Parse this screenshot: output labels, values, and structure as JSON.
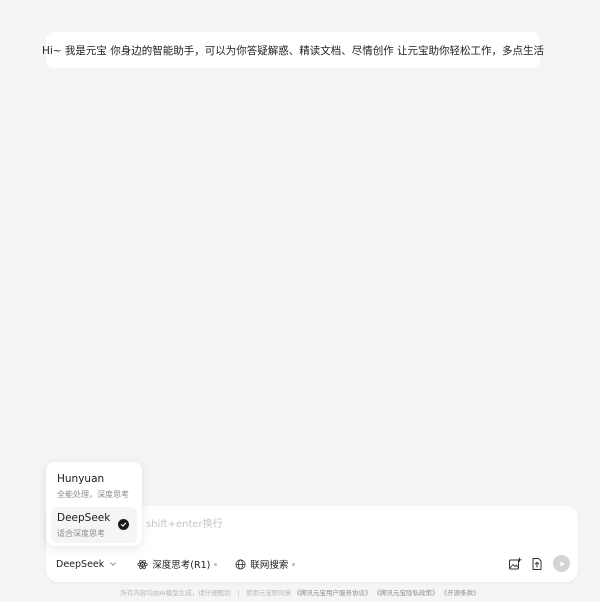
{
  "greeting": {
    "text": "Hi~ 我是元宝 你身边的智能助手，可以为你答疑解惑、精读文档、尽情创作 让元宝助你轻松工作，多点生活"
  },
  "model_menu": {
    "items": [
      {
        "name": "Hunyuan",
        "desc": "全能处理，深度思考"
      },
      {
        "name": "DeepSeek",
        "desc": "适合深度思考"
      }
    ],
    "selected": "DeepSeek"
  },
  "input": {
    "value": "",
    "placeholder": "shift+enter换行"
  },
  "toolbar": {
    "model_label": "DeepSeek",
    "deep_think_label": "深度思考(R1)",
    "web_search_label": "联网搜索"
  },
  "footer": {
    "disclaimer": "所有内容均由AI模型生成，请仔细甄别",
    "agreement_prefix": "使用元宝即同意",
    "link_user_agreement": "《腾讯元宝用户服务协议》",
    "link_privacy": "《腾讯元宝隐私政策》",
    "link_open_source": "《开源条款》"
  },
  "colors": {
    "background": "#f5f5f5",
    "surface": "#ffffff",
    "text": "#1a1a1a",
    "muted": "#8a8a8a",
    "placeholder": "#c4c4c4",
    "send_disabled": "#d4d4d4"
  },
  "icons": {
    "menu_check": "check-circle-icon",
    "model_chevron": "chevron-down-icon",
    "deep_think": "atom-icon",
    "web_search": "globe-icon",
    "image_upload": "image-plus-icon",
    "file_upload": "file-upload-icon",
    "send": "send-icon"
  }
}
